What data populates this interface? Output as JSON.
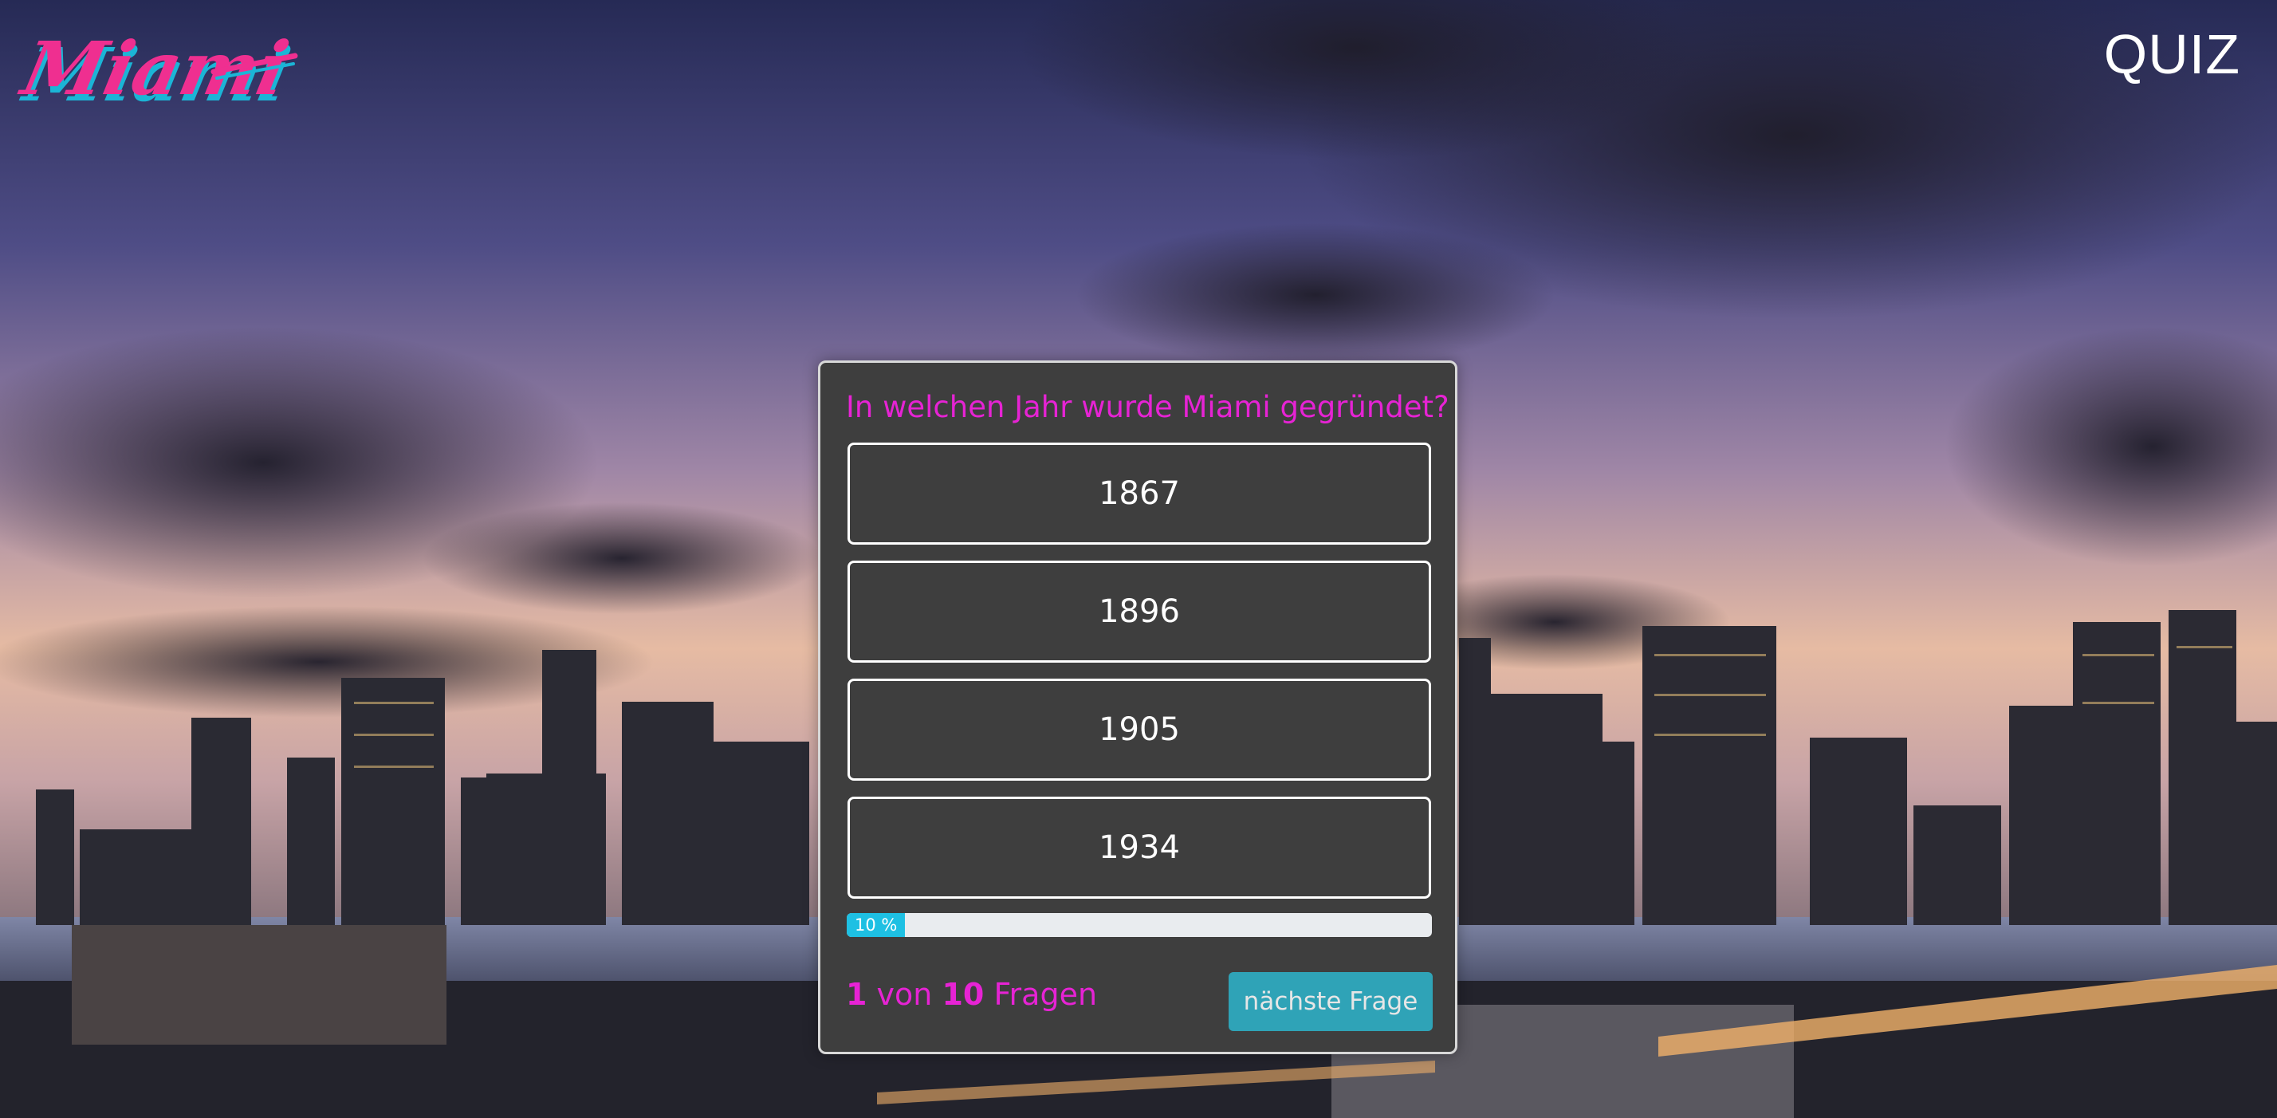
{
  "header": {
    "logo_text": "Miami",
    "title": "QUIZ"
  },
  "quiz": {
    "question": "In welchen Jahr wurde Miami gegründet?",
    "answers": [
      "1867",
      "1896",
      "1905",
      "1934"
    ],
    "progress_percent": 10,
    "progress_label": "10 %",
    "current": "1",
    "von": "von",
    "total": "10",
    "fragen": "Fragen",
    "next_label": "nächste Frage"
  },
  "colors": {
    "accent_magenta": "#e623d4",
    "button_teal": "#2fa3b7",
    "progress_fill": "#1ec0e3",
    "card_bg": "#3e3e3e"
  }
}
